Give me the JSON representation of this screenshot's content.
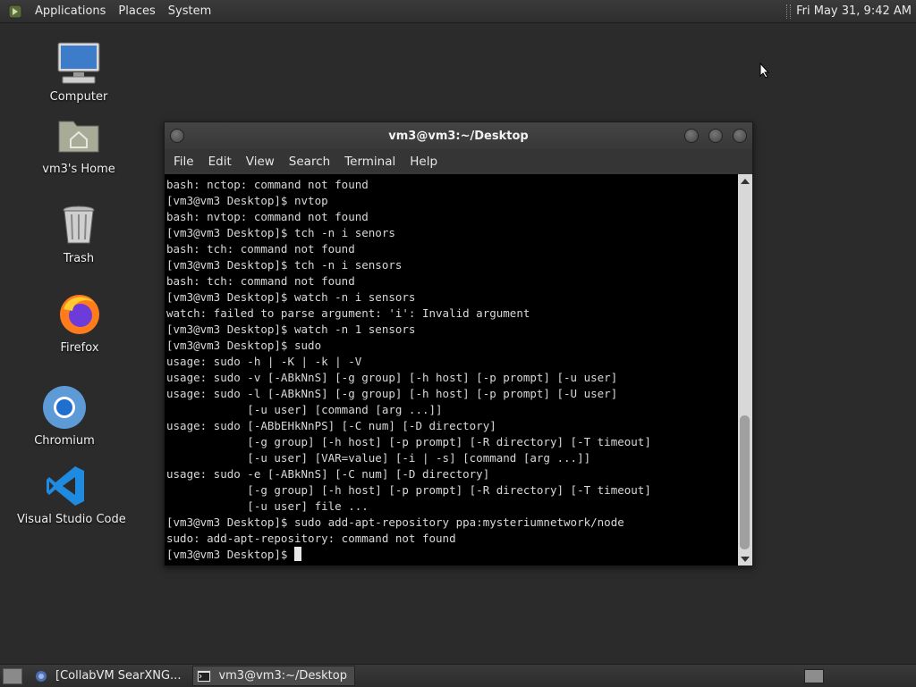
{
  "top_panel": {
    "menus": [
      "Applications",
      "Places",
      "System"
    ],
    "clock": "Fri May 31,  9:42 AM"
  },
  "desktop_icons": [
    {
      "label": "Computer",
      "icon": "computer-icon"
    },
    {
      "label": "vm3's Home",
      "icon": "home-folder-icon"
    },
    {
      "label": "Trash",
      "icon": "trash-icon"
    },
    {
      "label": "Firefox",
      "icon": "firefox-icon"
    },
    {
      "label": "Chromium",
      "icon": "chromium-icon"
    },
    {
      "label": "Visual Studio Code",
      "icon": "vscode-icon"
    }
  ],
  "terminal": {
    "title": "vm3@vm3:~/Desktop",
    "menu": [
      "File",
      "Edit",
      "View",
      "Search",
      "Terminal",
      "Help"
    ],
    "lines": [
      "bash: nctop: command not found",
      "[vm3@vm3 Desktop]$ nvtop",
      "bash: nvtop: command not found",
      "[vm3@vm3 Desktop]$ tch -n i senors",
      "bash: tch: command not found",
      "[vm3@vm3 Desktop]$ tch -n i sensors",
      "bash: tch: command not found",
      "[vm3@vm3 Desktop]$ watch -n i sensors",
      "watch: failed to parse argument: 'i': Invalid argument",
      "[vm3@vm3 Desktop]$ watch -n 1 sensors",
      "[vm3@vm3 Desktop]$ sudo",
      "usage: sudo -h | -K | -k | -V",
      "usage: sudo -v [-ABkNnS] [-g group] [-h host] [-p prompt] [-u user]",
      "usage: sudo -l [-ABkNnS] [-g group] [-h host] [-p prompt] [-U user]",
      "            [-u user] [command [arg ...]]",
      "usage: sudo [-ABbEHkNnPS] [-C num] [-D directory]",
      "            [-g group] [-h host] [-p prompt] [-R directory] [-T timeout]",
      "            [-u user] [VAR=value] [-i | -s] [command [arg ...]]",
      "usage: sudo -e [-ABkNnS] [-C num] [-D directory]",
      "            [-g group] [-h host] [-p prompt] [-R directory] [-T timeout]",
      "            [-u user] file ...",
      "[vm3@vm3 Desktop]$ sudo add-apt-repository ppa:mysteriumnetwork/node",
      "sudo: add-apt-repository: command not found"
    ],
    "prompt": "[vm3@vm3 Desktop]$"
  },
  "taskbar": {
    "tasks": [
      {
        "label": "[CollabVM SearXNG...",
        "icon": "browser-icon",
        "active": false
      },
      {
        "label": "vm3@vm3:~/Desktop",
        "icon": "terminal-icon",
        "active": true
      }
    ]
  }
}
